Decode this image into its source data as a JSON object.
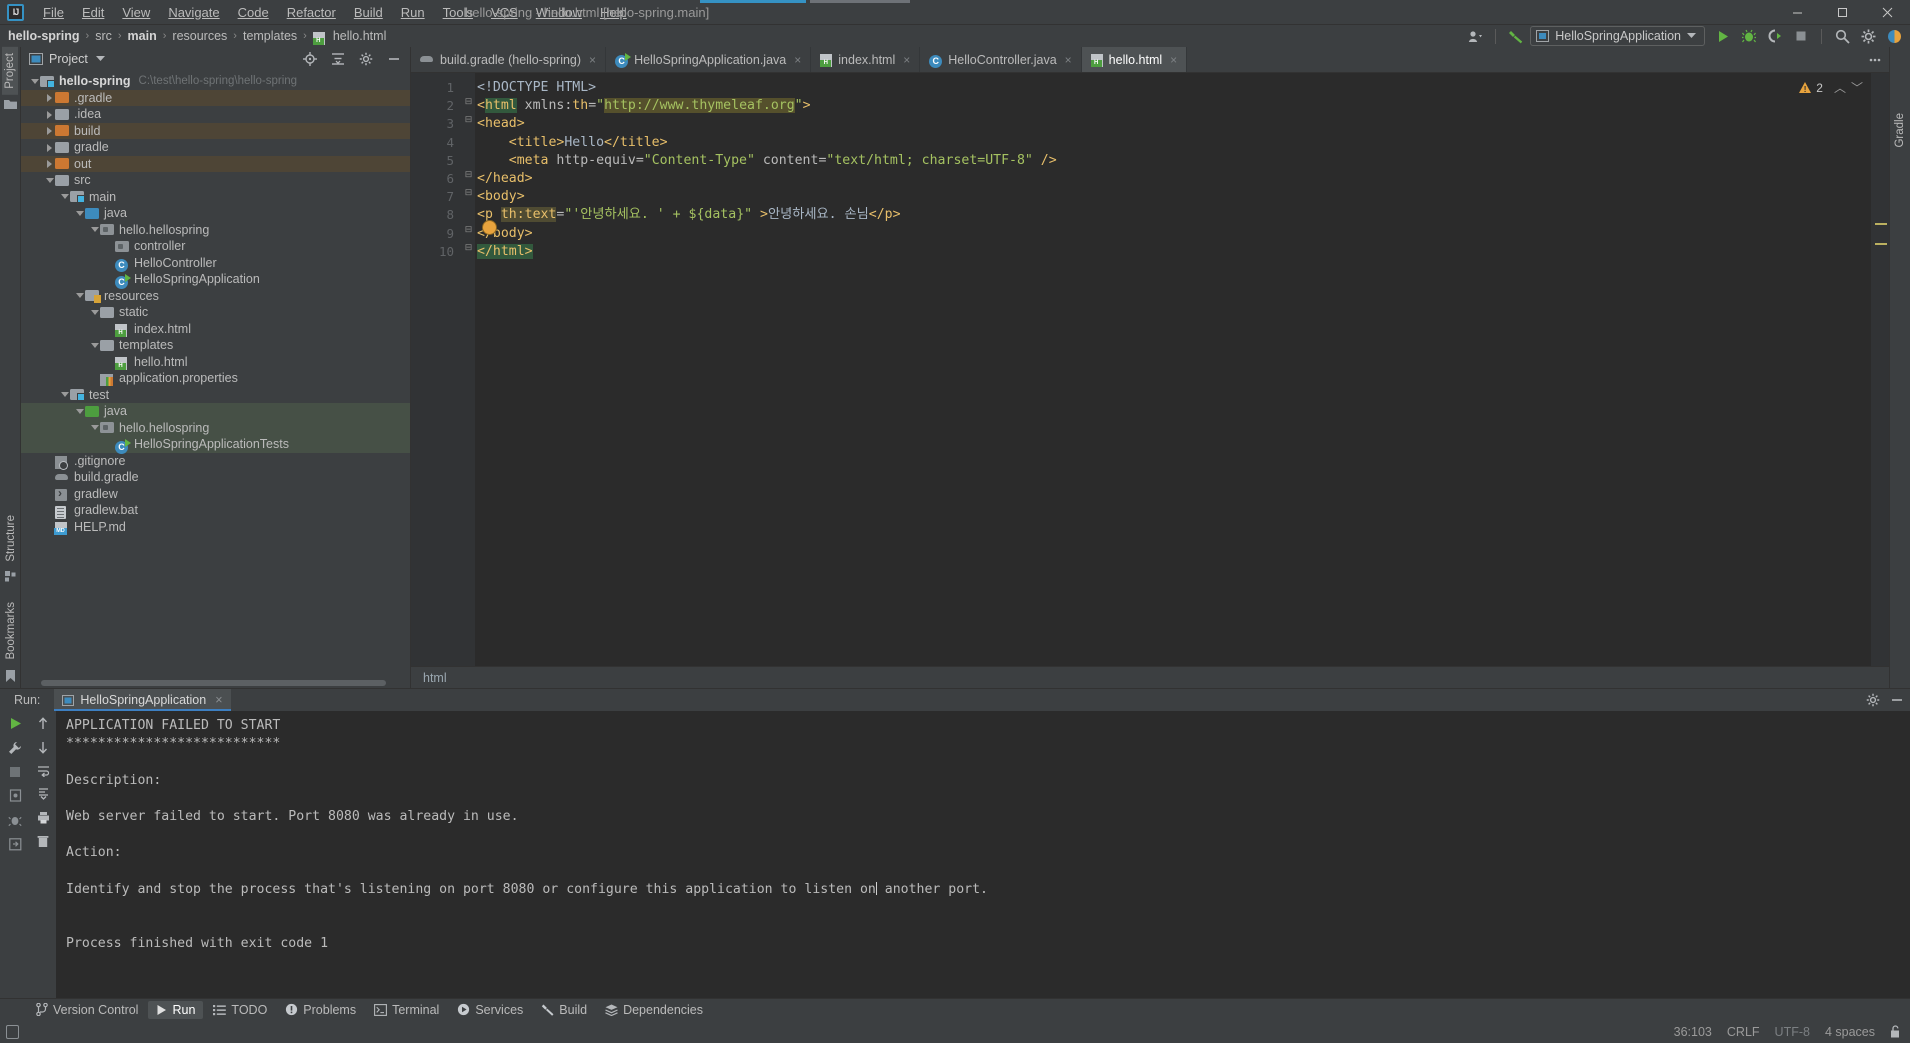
{
  "window": {
    "title": "hello-spring - hello.html [hello-spring.main]",
    "minimize": "—",
    "maximize": "☐",
    "close": "✕"
  },
  "menubar": {
    "items": [
      {
        "label": "File"
      },
      {
        "label": "Edit"
      },
      {
        "label": "View"
      },
      {
        "label": "Navigate"
      },
      {
        "label": "Code"
      },
      {
        "label": "Refactor"
      },
      {
        "label": "Build"
      },
      {
        "label": "Run"
      },
      {
        "label": "Tools"
      },
      {
        "label": "VCS"
      },
      {
        "label": "Window"
      },
      {
        "label": "Help"
      }
    ]
  },
  "navbar": {
    "crumbs": [
      "hello-spring",
      "src",
      "main",
      "resources",
      "templates",
      "hello.html"
    ],
    "separator": "›",
    "run_config": "HelloSpringApplication",
    "icons": [
      "user-icon",
      "hammer-icon",
      "run-icon",
      "debug-icon",
      "run-coverage-icon",
      "stop-icon",
      "search-icon",
      "gear-icon",
      "notifications-icon"
    ]
  },
  "project_panel": {
    "title": "Project",
    "header_icons": [
      "target-icon",
      "collapse-all-icon",
      "settings-icon",
      "hide-icon"
    ],
    "tree": [
      {
        "depth": 0,
        "label": "hello-spring",
        "path": "C:\\test\\hello-spring\\hello-spring",
        "icon": "module-folder",
        "arrow": "down",
        "bold": true,
        "hl": "none"
      },
      {
        "depth": 1,
        "label": ".gradle",
        "icon": "folder-orange",
        "arrow": "right",
        "hl": "brown"
      },
      {
        "depth": 1,
        "label": ".idea",
        "icon": "folder-grey",
        "arrow": "right",
        "hl": "none"
      },
      {
        "depth": 1,
        "label": "build",
        "icon": "folder-orange",
        "arrow": "right",
        "hl": "brown"
      },
      {
        "depth": 1,
        "label": "gradle",
        "icon": "folder-grey",
        "arrow": "right",
        "hl": "none"
      },
      {
        "depth": 1,
        "label": "out",
        "icon": "folder-orange",
        "arrow": "right",
        "hl": "brown"
      },
      {
        "depth": 1,
        "label": "src",
        "icon": "folder-grey",
        "arrow": "down",
        "hl": "none"
      },
      {
        "depth": 2,
        "label": "main",
        "icon": "module-folder",
        "arrow": "down",
        "hl": "none"
      },
      {
        "depth": 3,
        "label": "java",
        "icon": "folder-blue",
        "arrow": "down",
        "hl": "none"
      },
      {
        "depth": 4,
        "label": "hello.hellospring",
        "icon": "package",
        "arrow": "down",
        "hl": "none"
      },
      {
        "depth": 5,
        "label": "controller",
        "icon": "package",
        "arrow": "none",
        "hl": "none"
      },
      {
        "depth": 5,
        "label": "HelloController",
        "icon": "class",
        "arrow": "none",
        "hl": "none"
      },
      {
        "depth": 5,
        "label": "HelloSpringApplication",
        "icon": "class-runnable",
        "arrow": "none",
        "hl": "none"
      },
      {
        "depth": 3,
        "label": "resources",
        "icon": "folder-resources",
        "arrow": "down",
        "hl": "none"
      },
      {
        "depth": 4,
        "label": "static",
        "icon": "folder-grey",
        "arrow": "down",
        "hl": "none"
      },
      {
        "depth": 5,
        "label": "index.html",
        "icon": "html-file",
        "arrow": "none",
        "hl": "none"
      },
      {
        "depth": 4,
        "label": "templates",
        "icon": "folder-grey",
        "arrow": "down",
        "hl": "none"
      },
      {
        "depth": 5,
        "label": "hello.html",
        "icon": "html-file",
        "arrow": "none",
        "hl": "none"
      },
      {
        "depth": 4,
        "label": "application.properties",
        "icon": "properties-file",
        "arrow": "none",
        "hl": "none"
      },
      {
        "depth": 2,
        "label": "test",
        "icon": "module-folder",
        "arrow": "down",
        "hl": "none"
      },
      {
        "depth": 3,
        "label": "java",
        "icon": "folder-green",
        "arrow": "down",
        "hl": "green"
      },
      {
        "depth": 4,
        "label": "hello.hellospring",
        "icon": "package",
        "arrow": "down",
        "hl": "green"
      },
      {
        "depth": 5,
        "label": "HelloSpringApplicationTests",
        "icon": "class-runnable",
        "arrow": "none",
        "hl": "green"
      },
      {
        "depth": 1,
        "label": ".gitignore",
        "icon": "gitignore-file",
        "arrow": "none",
        "hl": "none"
      },
      {
        "depth": 1,
        "label": "build.gradle",
        "icon": "gradle-file",
        "arrow": "none",
        "hl": "none"
      },
      {
        "depth": 1,
        "label": "gradlew",
        "icon": "exec-file",
        "arrow": "none",
        "hl": "none"
      },
      {
        "depth": 1,
        "label": "gradlew.bat",
        "icon": "bat-file",
        "arrow": "none",
        "hl": "none"
      },
      {
        "depth": 1,
        "label": "HELP.md",
        "icon": "markdown-file",
        "arrow": "none",
        "hl": "none"
      }
    ]
  },
  "left_rail": {
    "tabs": [
      {
        "label": "Project",
        "icon": "project-icon",
        "active": true
      },
      {
        "label": "Bookmarks",
        "icon": "bookmark-icon",
        "active": false
      },
      {
        "label": "Structure",
        "icon": "structure-icon",
        "active": false
      }
    ]
  },
  "right_rail": {
    "tabs": [
      {
        "label": "Gradle",
        "icon": "gradle-icon"
      }
    ]
  },
  "editor": {
    "tabs": [
      {
        "label": "build.gradle (hello-spring)",
        "icon": "gradle-file",
        "active": false
      },
      {
        "label": "HelloSpringApplication.java",
        "icon": "class-runnable",
        "active": false
      },
      {
        "label": "index.html",
        "icon": "html-file",
        "active": false
      },
      {
        "label": "HelloController.java",
        "icon": "class",
        "active": false
      },
      {
        "label": "hello.html",
        "icon": "html-file",
        "active": true
      }
    ],
    "close_glyph": "×",
    "warnings_count": "2",
    "line_numbers": [
      "1",
      "2",
      "3",
      "4",
      "5",
      "6",
      "7",
      "8",
      "9",
      "10"
    ],
    "lines": [
      "<!DOCTYPE HTML>",
      "<html xmlns:th=\"http://www.thymeleaf.org\">",
      "<head>",
      "    <title>Hello</title>",
      "    <meta http-equiv=\"Content-Type\" content=\"text/html; charset=UTF-8\" />",
      "</head>",
      "<body>",
      "<p th:text=\"'안녕하세요. ' + ${data}\" >안녕하세요. 손님</p>",
      "</body>",
      "</html>"
    ],
    "breadcrumb": "html"
  },
  "run_panel": {
    "label": "Run:",
    "tab": "HelloSpringApplication",
    "close_glyph": "×",
    "console_lines": [
      "APPLICATION FAILED TO START",
      "***************************",
      "",
      "Description:",
      "",
      "Web server failed to start. Port 8080 was already in use.",
      "",
      "Action:",
      "",
      "Identify and stop the process that's listening on port 8080 or configure this application to listen on another port.",
      "",
      "",
      "Process finished with exit code 1"
    ],
    "rail_a_icons": [
      "rerun-icon",
      "wrench-icon",
      "stop-icon",
      "dump-threads-icon",
      "debug-icon",
      "export-icon"
    ],
    "rail_b_icons": [
      "scroll-up-icon",
      "scroll-down-icon",
      "soft-wrap-icon",
      "scroll-to-end-icon",
      "print-icon",
      "clear-all-icon"
    ],
    "header_icons": [
      "settings-icon",
      "hide-icon"
    ]
  },
  "toolwindow_bar": {
    "items": [
      {
        "label": "Version Control",
        "icon": "branch-icon",
        "active": false
      },
      {
        "label": "Run",
        "icon": "run-icon",
        "active": true
      },
      {
        "label": "TODO",
        "icon": "list-icon",
        "active": false
      },
      {
        "label": "Problems",
        "icon": "problems-icon",
        "active": false
      },
      {
        "label": "Terminal",
        "icon": "terminal-icon",
        "active": false
      },
      {
        "label": "Services",
        "icon": "services-icon",
        "active": false
      },
      {
        "label": "Build",
        "icon": "hammer-icon",
        "active": false
      },
      {
        "label": "Dependencies",
        "icon": "layers-icon",
        "active": false
      }
    ]
  },
  "statusbar": {
    "left_icon": "memory-icon",
    "caret_position": "36:103",
    "line_separator": "CRLF",
    "encoding": "UTF-8",
    "indent": "4 spaces",
    "lock_icon": "unlocked-icon"
  },
  "colors": {
    "accent": "#3592c4",
    "bg": "#3c3f41",
    "editor_bg": "#2b2b2b",
    "tag": "#e8bf6a",
    "string": "#a5c261",
    "text": "#a9b7c6",
    "warn": "#e8a33d",
    "green": "#62b543"
  }
}
